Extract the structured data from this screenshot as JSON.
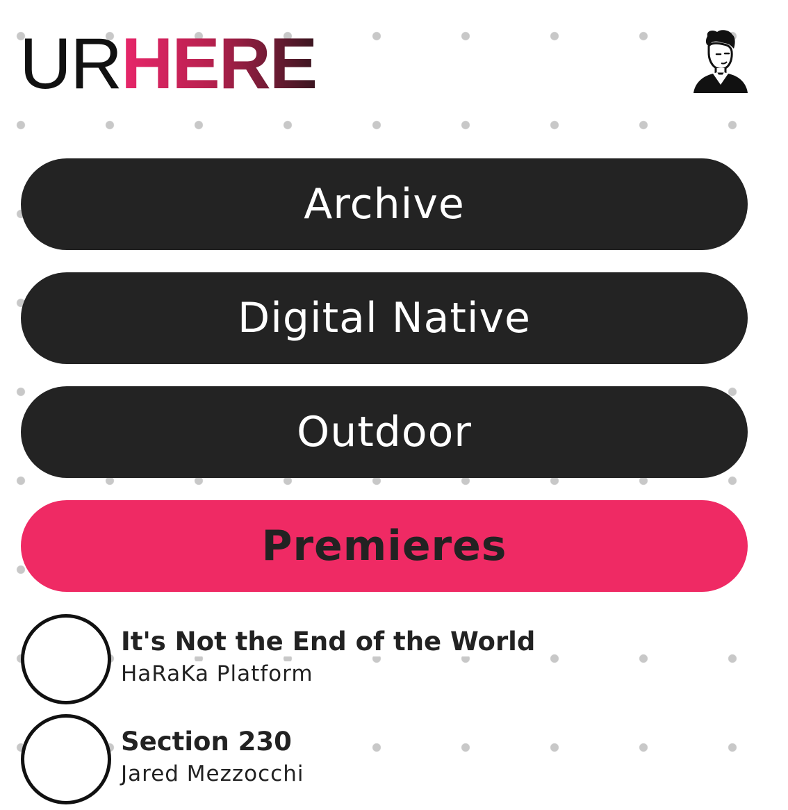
{
  "header": {
    "logo_light": "UR",
    "logo_bold": "HERE",
    "profile_icon": "person-avatar-icon"
  },
  "nav": {
    "items": [
      {
        "label": "Archive",
        "active": false
      },
      {
        "label": "Digital Native",
        "active": false
      },
      {
        "label": "Outdoor",
        "active": false
      },
      {
        "label": "Premieres",
        "active": true
      }
    ]
  },
  "premieres": [
    {
      "title": "It's Not the End of the World",
      "subtitle": "HaRaKa Platform"
    },
    {
      "title": "Section 230",
      "subtitle": "Jared Mezzocchi"
    }
  ],
  "colors": {
    "accent": "#ef2a64",
    "button_dark": "#232323",
    "dot": "#c8c8c8"
  }
}
